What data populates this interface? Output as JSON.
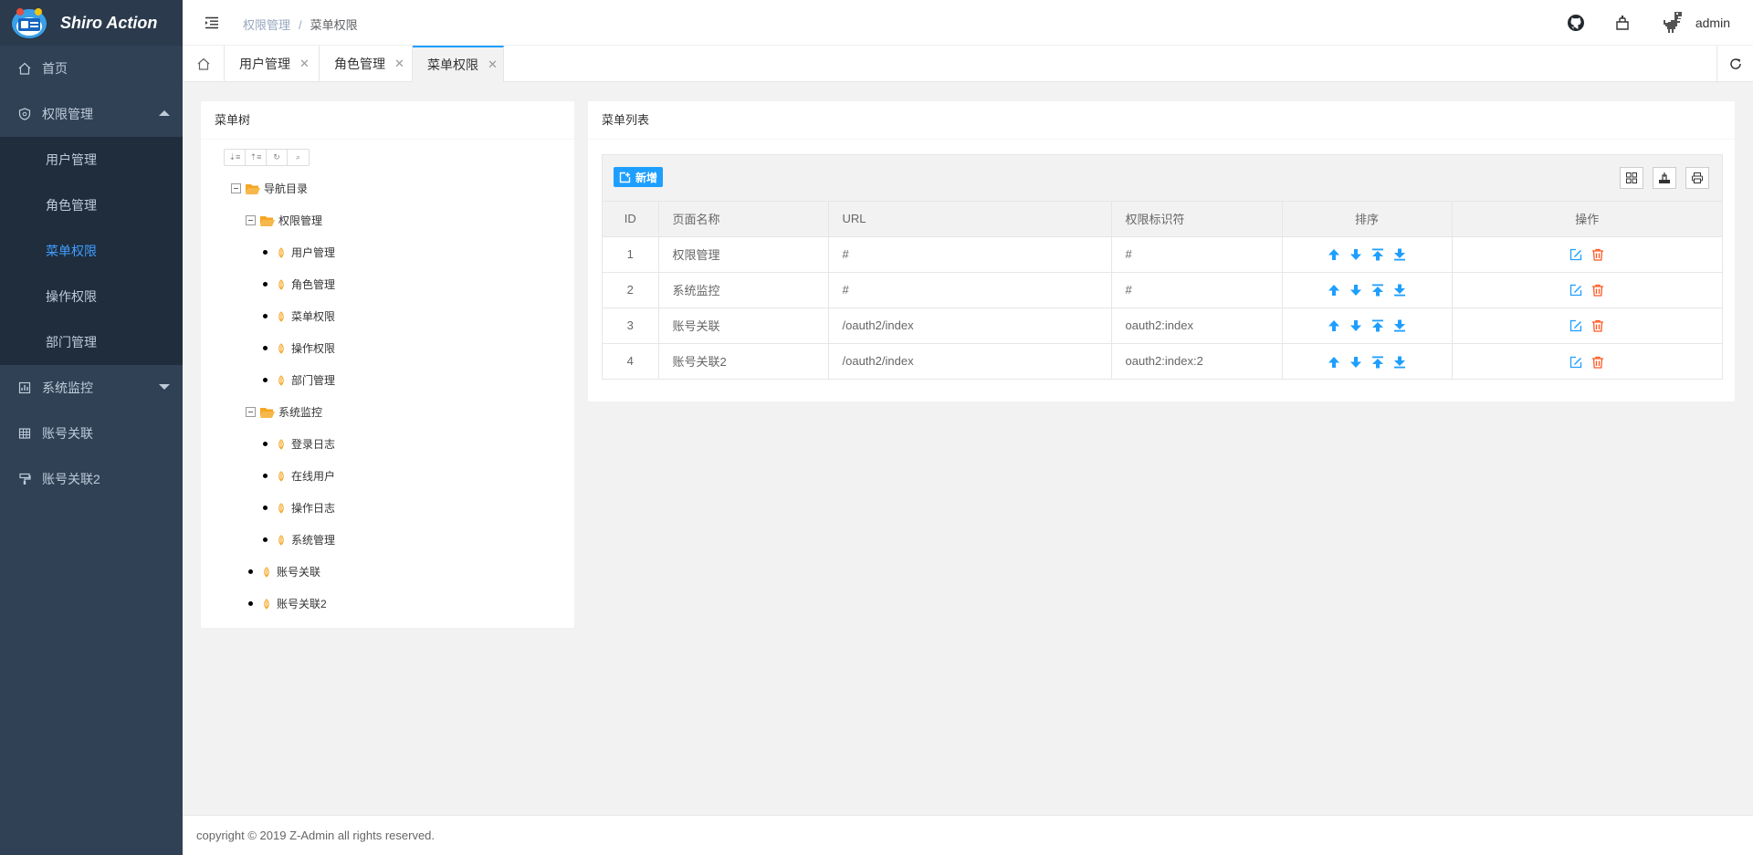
{
  "app": {
    "title": "Shiro Action"
  },
  "sidebar": {
    "items": [
      {
        "label": "首页",
        "icon": "home-icon"
      },
      {
        "label": "权限管理",
        "icon": "shield-icon",
        "expanded": true
      },
      {
        "label": "系统监控",
        "icon": "monitor-icon",
        "expanded": false
      },
      {
        "label": "账号关联",
        "icon": "table-icon"
      },
      {
        "label": "账号关联2",
        "icon": "brush-icon"
      }
    ],
    "submenu": [
      {
        "label": "用户管理"
      },
      {
        "label": "角色管理"
      },
      {
        "label": "菜单权限",
        "active": true
      },
      {
        "label": "操作权限"
      },
      {
        "label": "部门管理"
      }
    ]
  },
  "header": {
    "breadcrumb": [
      "权限管理",
      "菜单权限"
    ],
    "breadcrumb_sep": "/",
    "username": "admin"
  },
  "tabs": [
    {
      "label": "用户管理",
      "close": "✕"
    },
    {
      "label": "角色管理",
      "close": "✕"
    },
    {
      "label": "菜单权限",
      "close": "✕",
      "active": true
    }
  ],
  "tree_panel": {
    "title": "菜单树",
    "nodes": [
      {
        "label": "导航目录"
      },
      {
        "label": "权限管理"
      },
      {
        "label": "用户管理"
      },
      {
        "label": "角色管理"
      },
      {
        "label": "菜单权限"
      },
      {
        "label": "操作权限"
      },
      {
        "label": "部门管理"
      },
      {
        "label": "系统监控"
      },
      {
        "label": "登录日志"
      },
      {
        "label": "在线用户"
      },
      {
        "label": "操作日志"
      },
      {
        "label": "系统管理"
      },
      {
        "label": "账号关联"
      },
      {
        "label": "账号关联2"
      }
    ]
  },
  "list_panel": {
    "title": "菜单列表",
    "add_label": "新增",
    "columns": [
      "ID",
      "页面名称",
      "URL",
      "权限标识符",
      "排序",
      "操作"
    ],
    "rows": [
      {
        "id": "1",
        "name": "权限管理",
        "url": "#",
        "perm": "#"
      },
      {
        "id": "2",
        "name": "系统监控",
        "url": "#",
        "perm": "#"
      },
      {
        "id": "3",
        "name": "账号关联",
        "url": "/oauth2/index",
        "perm": "oauth2:index"
      },
      {
        "id": "4",
        "name": "账号关联2",
        "url": "/oauth2/index",
        "perm": "oauth2:index:2"
      }
    ]
  },
  "footer": {
    "text": "copyright © 2019 Z-Admin all rights reserved."
  },
  "colors": {
    "sidebar": "#304156",
    "submenu": "#1f2d3d",
    "accent": "#1e9fff",
    "active_menu": "#409eff",
    "delete": "#ff5722",
    "folder": "#f5a623"
  }
}
